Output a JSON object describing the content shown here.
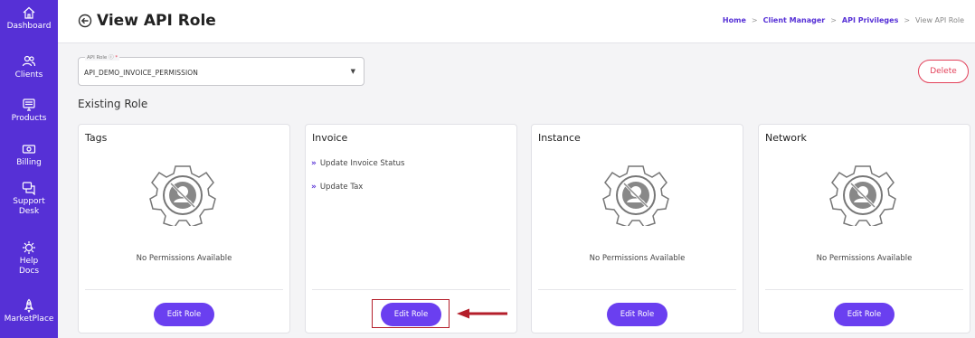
{
  "sidebar": {
    "items": [
      {
        "label": "Dashboard",
        "icon": "home-icon"
      },
      {
        "label": "Clients",
        "icon": "users-icon"
      },
      {
        "label": "Products",
        "icon": "monitor-icon"
      },
      {
        "label": "Billing",
        "icon": "cash-icon"
      },
      {
        "label": "Support",
        "label2": "Desk",
        "icon": "chat-icon"
      },
      {
        "label": "Help",
        "label2": "Docs",
        "icon": "gear-icon"
      },
      {
        "label": "MarketPlace",
        "icon": "rocket-icon"
      }
    ]
  },
  "header": {
    "title": "View API Role",
    "breadcrumb": {
      "home": "Home",
      "client_manager": "Client Manager",
      "api_privileges": "API Privileges",
      "current": "View API Role"
    }
  },
  "form": {
    "api_role_label": "API Role",
    "api_role_required": "*",
    "api_role_value": "API_DEMO_INVOICE_PERMISSION"
  },
  "delete_label": "Delete",
  "section_title": "Existing Role",
  "cards": [
    {
      "title": "Tags",
      "empty_text": "No Permissions Available",
      "edit_label": "Edit Role"
    },
    {
      "title": "Invoice",
      "permissions": [
        "Update Invoice Status",
        "Update Tax"
      ],
      "edit_label": "Edit Role"
    },
    {
      "title": "Instance",
      "empty_text": "No Permissions Available",
      "edit_label": "Edit Role"
    },
    {
      "title": "Network",
      "empty_text": "No Permissions Available",
      "edit_label": "Edit Role"
    }
  ],
  "colors": {
    "sidebar": "#5630d6",
    "primary_button": "#6a3ff0",
    "delete": "#e3415a",
    "annotation": "#b41e2a"
  },
  "icons": {
    "back": "back-arrow-icon",
    "no_permission": "no-permission-gear-icon",
    "list_bullet": "double-chevron-right-icon",
    "caret": "caret-down-icon"
  }
}
